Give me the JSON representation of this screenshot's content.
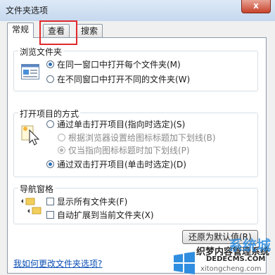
{
  "window": {
    "title": "文件夹选项",
    "close_label": "x"
  },
  "tabs": [
    {
      "label": "常规"
    },
    {
      "label": "查看"
    },
    {
      "label": "搜索"
    }
  ],
  "browse_group": {
    "title": "浏览文件夹",
    "options": [
      {
        "label": "在同一窗口中打开每个文件夹(M)",
        "checked": true
      },
      {
        "label": "在不同窗口中打开不同的文件夹(W)",
        "checked": false
      }
    ]
  },
  "click_group": {
    "title": "打开项目的方式",
    "options": [
      {
        "label": "通过单击打开项目(指向时选定)(S)",
        "checked": false
      },
      {
        "label": "根据浏览器设置给图标标题加下划线(B)",
        "checked": false,
        "disabled": true
      },
      {
        "label": "仅当指向图标标题时加下划线(P)",
        "checked": true,
        "disabled": true
      },
      {
        "label": "通过双击打开项目(单击时选定)(D)",
        "checked": true
      }
    ]
  },
  "nav_group": {
    "title": "导航窗格",
    "options": [
      {
        "label": "显示所有文件夹(F)",
        "checked": false
      },
      {
        "label": "自动扩展到当前文件夹(X)",
        "checked": false
      }
    ]
  },
  "restore_button": "还原为默认值(R)",
  "help_link": "我如何更改文件夹选项?",
  "watermark": {
    "line1": "织梦内容管理系统",
    "line2": "DEDECMS.COM",
    "line3": "系统城",
    "line4": "xitongcheng.com"
  },
  "colors": {
    "highlight_border": "#e0282a",
    "link": "#0b4fb5",
    "selected_radio": "#2a6fb7"
  }
}
